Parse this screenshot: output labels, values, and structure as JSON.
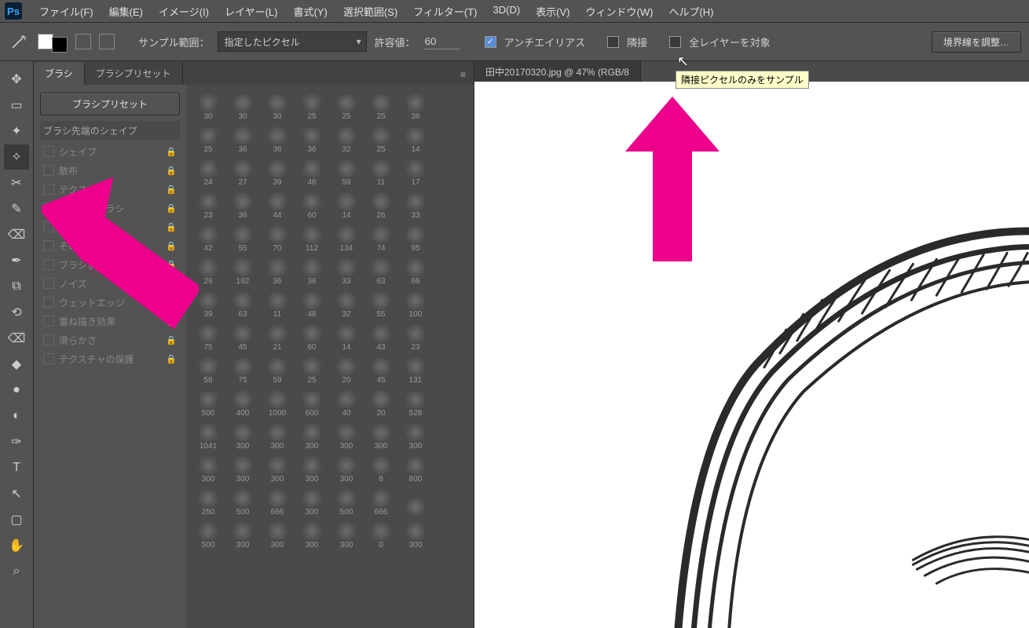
{
  "app_icon": "Ps",
  "menu": [
    {
      "label": "ファイル(F)"
    },
    {
      "label": "編集(E)"
    },
    {
      "label": "イメージ(I)"
    },
    {
      "label": "レイヤー(L)"
    },
    {
      "label": "書式(Y)"
    },
    {
      "label": "選択範囲(S)"
    },
    {
      "label": "フィルター(T)"
    },
    {
      "label": "3D(D)"
    },
    {
      "label": "表示(V)"
    },
    {
      "label": "ウィンドウ(W)"
    },
    {
      "label": "ヘルプ(H)"
    }
  ],
  "options": {
    "sample_label": "サンプル範囲：",
    "sample_value": "指定したピクセル",
    "tolerance_label": "許容値：",
    "tolerance_value": "60",
    "antialias": "アンチエイリアス",
    "contiguous": "隣接",
    "all_layers": "全レイヤーを対象",
    "refine": "境界線を調整…"
  },
  "doc_tab": "田中20170320.jpg @ 47% (RGB/8",
  "tooltip": "隣接ピクセルのみをサンプル",
  "panel": {
    "tab_brush": "ブラシ",
    "tab_presets": "ブラシプリセット",
    "preset_btn": "ブラシプリセット",
    "tip_shape": "ブラシ先端のシェイプ",
    "rows": [
      {
        "label": "シェイプ"
      },
      {
        "label": "散布"
      },
      {
        "label": "テクスチャ"
      },
      {
        "label": "デュアルブラシ"
      },
      {
        "label": "カラー"
      },
      {
        "label": "その他"
      },
      {
        "label": "ブラシポーズ"
      },
      {
        "label": "ノイズ"
      },
      {
        "label": "ウェットエッジ"
      },
      {
        "label": "重ね描き効果"
      },
      {
        "label": "滑らかさ"
      },
      {
        "label": "テクスチャの保護"
      }
    ]
  },
  "brush_sizes": [
    [
      30,
      30,
      30,
      25,
      25,
      25,
      36
    ],
    [
      25,
      36,
      36,
      36,
      32,
      25,
      14
    ],
    [
      24,
      27,
      39,
      46,
      59,
      11,
      17
    ],
    [
      23,
      36,
      44,
      60,
      14,
      26,
      33
    ],
    [
      42,
      55,
      70,
      112,
      134,
      74,
      95
    ],
    [
      29,
      192,
      36,
      36,
      33,
      63,
      66
    ],
    [
      39,
      63,
      11,
      48,
      32,
      55,
      100
    ],
    [
      75,
      45,
      21,
      60,
      14,
      43,
      23
    ],
    [
      58,
      75,
      59,
      25,
      20,
      45,
      131
    ],
    [
      500,
      400,
      1000,
      600,
      40,
      20,
      528
    ],
    [
      1041,
      300,
      300,
      300,
      300,
      300,
      300
    ],
    [
      300,
      300,
      300,
      300,
      300,
      8,
      800
    ],
    [
      250,
      500,
      666,
      300,
      500,
      666,
      ""
    ],
    [
      500,
      300,
      300,
      300,
      300,
      0,
      300
    ]
  ],
  "tools": [
    {
      "g": "✥",
      "name": "move-tool"
    },
    {
      "g": "▭",
      "name": "marquee-tool"
    },
    {
      "g": "✦",
      "name": "lasso-tool"
    },
    {
      "g": "✧",
      "name": "magic-wand-tool",
      "active": true
    },
    {
      "g": "✂",
      "name": "crop-tool"
    },
    {
      "g": "✎",
      "name": "eyedropper-tool"
    },
    {
      "g": "⌫",
      "name": "spot-heal-tool"
    },
    {
      "g": "✒",
      "name": "brush-tool"
    },
    {
      "g": "⧉",
      "name": "clone-stamp-tool"
    },
    {
      "g": "⟲",
      "name": "history-brush-tool"
    },
    {
      "g": "⌫",
      "name": "eraser-tool"
    },
    {
      "g": "◆",
      "name": "gradient-tool"
    },
    {
      "g": "●",
      "name": "blur-tool"
    },
    {
      "g": "◐",
      "name": "dodge-tool"
    },
    {
      "g": "✑",
      "name": "pen-tool"
    },
    {
      "g": "T",
      "name": "type-tool"
    },
    {
      "g": "↖",
      "name": "path-select-tool"
    },
    {
      "g": "▢",
      "name": "rectangle-tool"
    },
    {
      "g": "✋",
      "name": "hand-tool"
    },
    {
      "g": "⌕",
      "name": "zoom-tool"
    }
  ]
}
